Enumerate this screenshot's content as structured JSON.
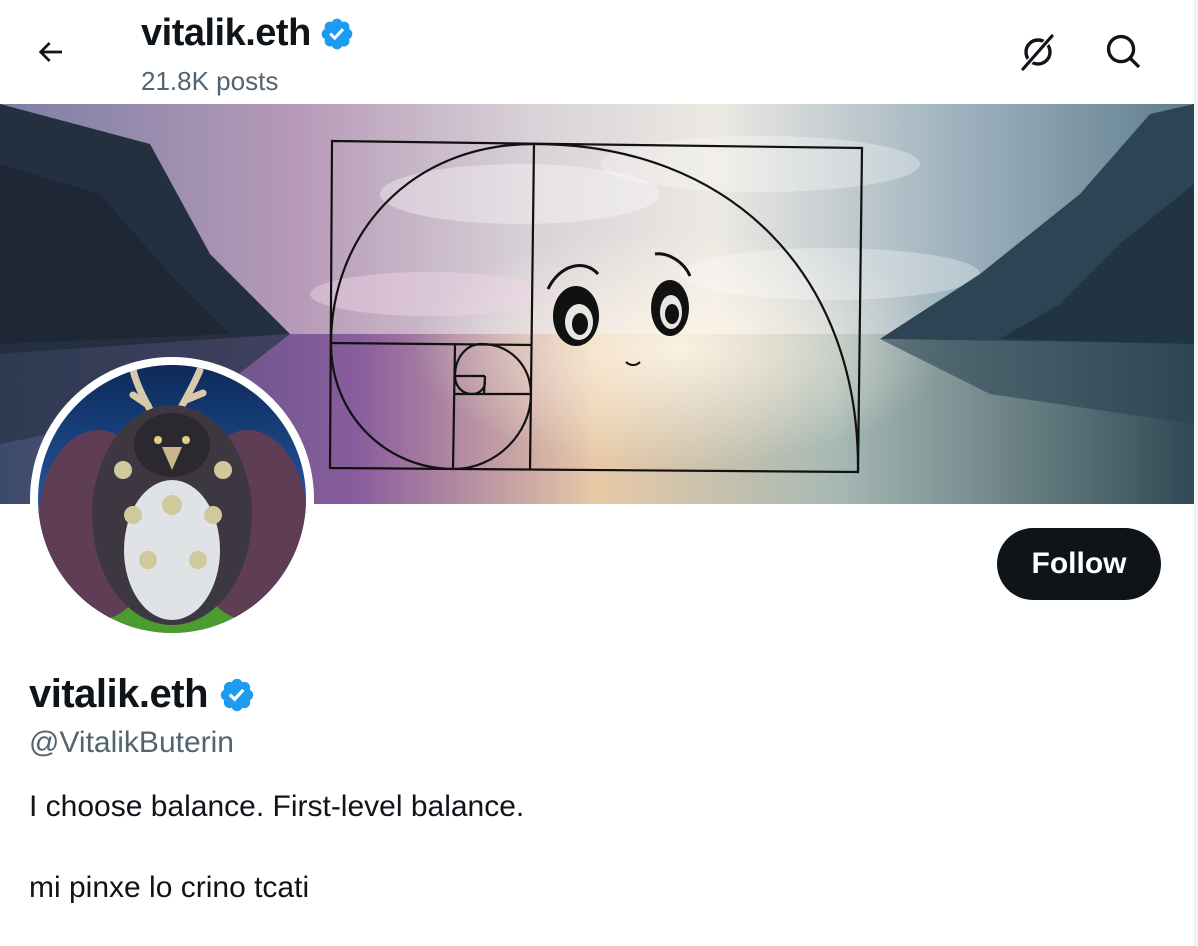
{
  "header": {
    "back_icon": "arrow-left-icon",
    "title": "vitalik.eth",
    "posts_count": "21.8K posts",
    "grok_icon": "grok-icon",
    "search_icon": "search-icon"
  },
  "profile": {
    "name": "vitalik.eth",
    "verified_icon": "verified-badge-icon",
    "handle": "@VitalikButerin",
    "bio_line_1": "I choose balance. First-level balance.",
    "bio_line_2": "mi pinxe lo crino tcati",
    "follow_label": "Follow"
  },
  "colors": {
    "verified": "#1d9bf0",
    "secondary_text": "#536471",
    "primary_text": "#0f1419",
    "follow_bg": "#0f1419"
  }
}
